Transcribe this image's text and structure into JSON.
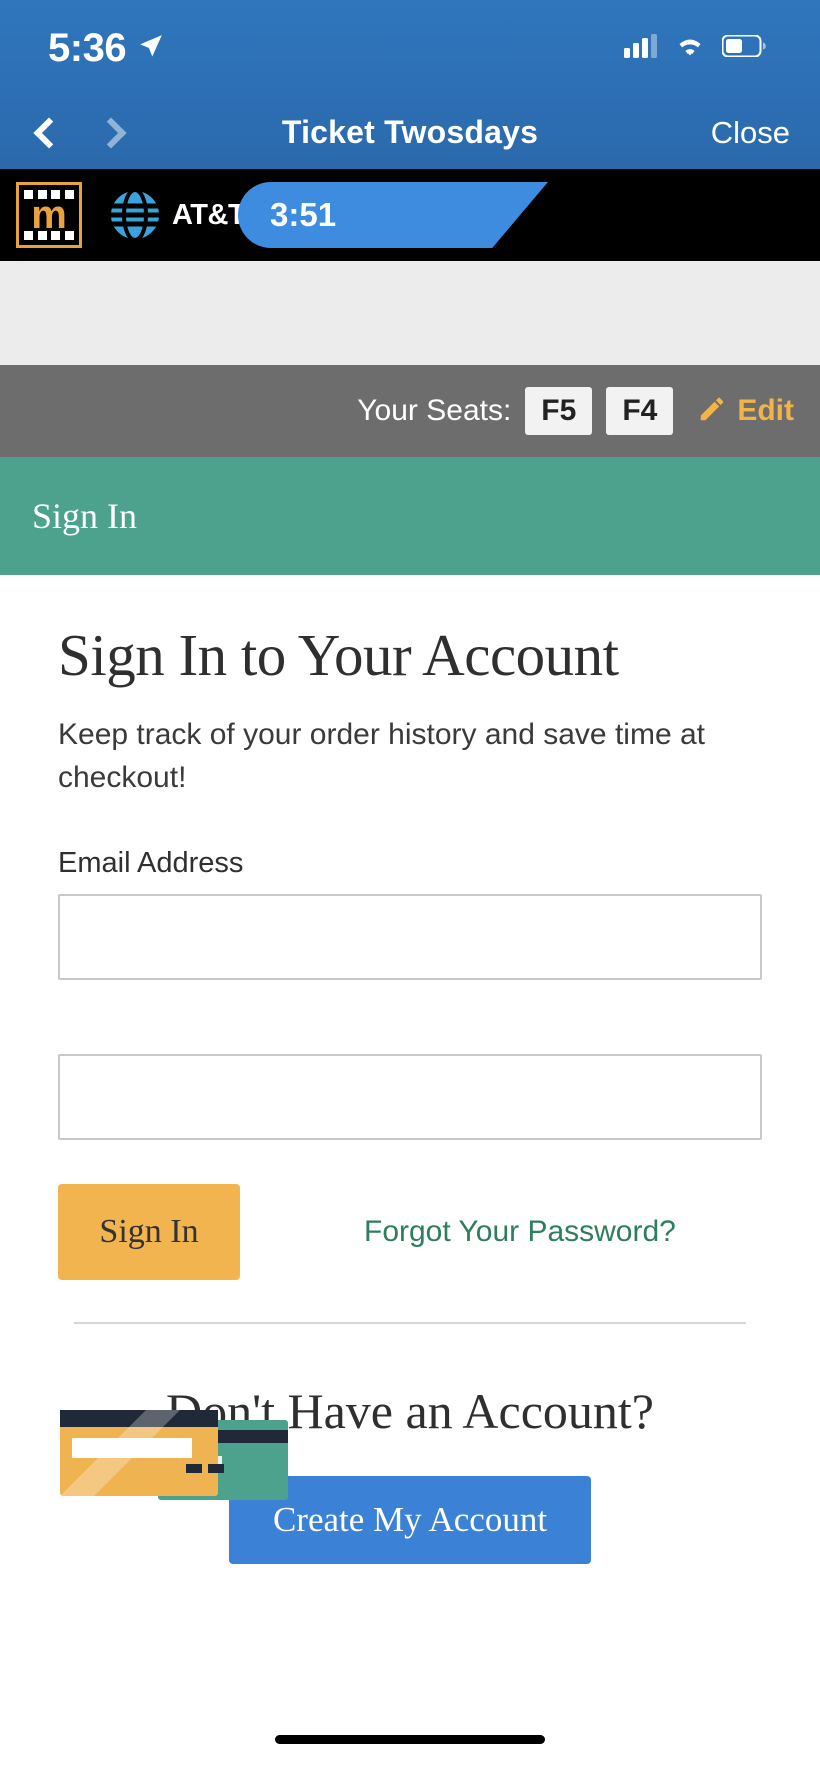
{
  "status_bar": {
    "time": "5:36",
    "location_icon": "location-arrow-icon",
    "signal_icon": "cellular-signal-icon",
    "wifi_icon": "wifi-icon",
    "battery_icon": "battery-icon"
  },
  "nav": {
    "back_icon": "chevron-left-icon",
    "forward_icon": "chevron-right-icon",
    "title": "Ticket Twosdays",
    "close_label": "Close"
  },
  "brand_bar": {
    "logo_letter": "m",
    "logo_name": "marcus-theatres-logo",
    "carrier": "AT&T",
    "timer": "3:51"
  },
  "seats": {
    "label": "Your Seats:",
    "chips": [
      "F5",
      "F4"
    ],
    "edit_label": "Edit",
    "edit_icon": "pencil-icon"
  },
  "section_header": {
    "title": "Sign In"
  },
  "main": {
    "heading": "Sign In to Your Account",
    "description": "Keep track of your order history and save time at checkout!",
    "email_label": "Email Address",
    "email_value": "",
    "email_placeholder": "",
    "password_value": "",
    "password_placeholder": "",
    "signin_button": "Sign In",
    "forgot_link": "Forgot Your Password?"
  },
  "create_account": {
    "heading": "Don't Have an Account?",
    "button": "Create My Account"
  },
  "illustration": {
    "name": "credit-cards-illustration"
  },
  "colors": {
    "ios_blue": "#2d6fb4",
    "brand_black": "#000000",
    "timer_blue": "#3d8ce0",
    "seats_gray": "#6d6d6d",
    "section_green": "#4ca28c",
    "amber": "#F2B44F",
    "link_green": "#2e7d5b",
    "create_blue": "#3b82d6",
    "logo_gold": "#E8A33D"
  }
}
